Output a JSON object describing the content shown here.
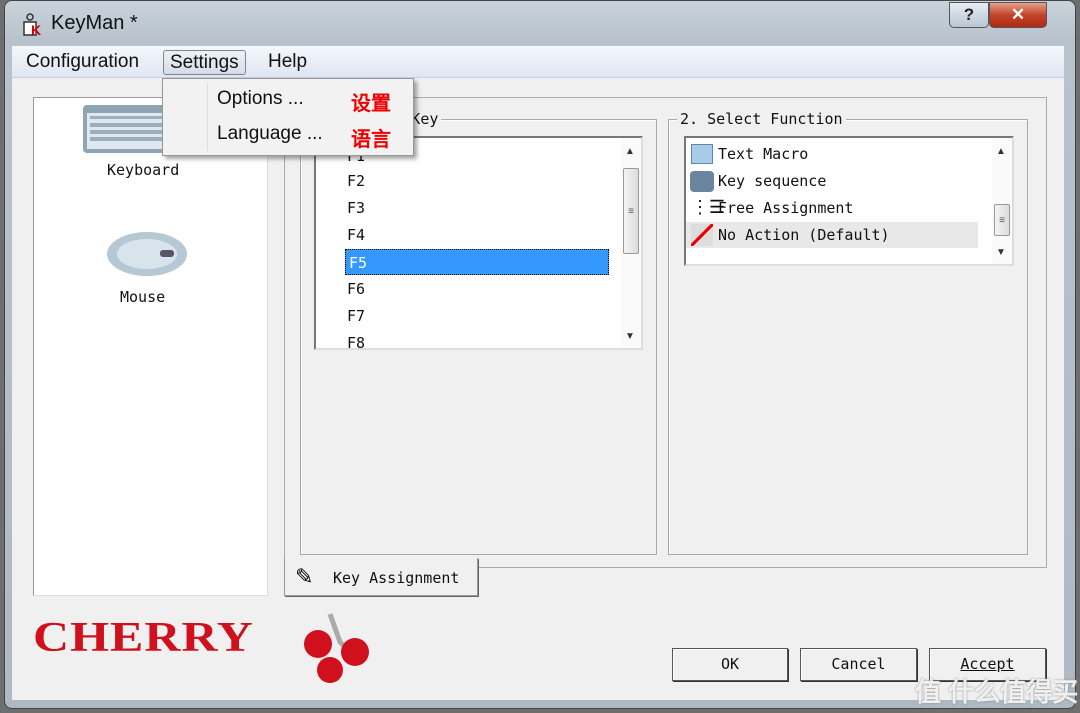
{
  "window": {
    "title": "KeyMan *",
    "help_label": "?",
    "close_label": "✕"
  },
  "menu": {
    "items": [
      "Configuration",
      "Settings",
      "Help"
    ],
    "dropdown": [
      {
        "label": "Options ...",
        "annotation": "设置"
      },
      {
        "label": "Language ...",
        "annotation": "语言"
      }
    ]
  },
  "devices": [
    {
      "label": "Keyboard",
      "icon": "keyboard-icon"
    },
    {
      "label": "Mouse",
      "icon": "mouse-icon"
    }
  ],
  "select_key": {
    "label": "1. Select Key",
    "items": [
      "F1",
      "F2",
      "F3",
      "F4",
      "F5",
      "F6",
      "F7",
      "F8"
    ],
    "selected": "F5"
  },
  "select_function": {
    "label": "2. Select Function",
    "items": [
      {
        "label": "Text Macro",
        "icon": "pencil-icon"
      },
      {
        "label": "Key sequence",
        "icon": "key-sequence-icon"
      },
      {
        "label": "Free Assignment",
        "icon": "list-icon"
      },
      {
        "label": "No Action (Default)",
        "icon": "no-action-icon"
      }
    ],
    "selected": "No Action (Default)"
  },
  "tab": {
    "label": "Key Assignment"
  },
  "buttons": {
    "ok": "OK",
    "cancel": "Cancel",
    "accept": "Accept"
  },
  "logo": {
    "text": "CHERRY",
    "color": "#d0101c"
  },
  "watermark": "值 什么值得买",
  "colors": {
    "selection": "#3399ff",
    "annotation": "#e00000"
  }
}
